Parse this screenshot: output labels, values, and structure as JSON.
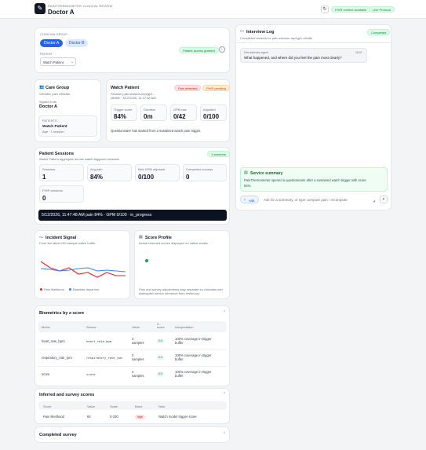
{
  "header": {
    "app_subtitle": "PainThermometer Clinical Review",
    "title": "Doctor A",
    "status_pills": [
      "FHIR context available",
      "Live Protocol"
    ]
  },
  "clinician": {
    "group_label": "Clinician group",
    "options": [
      "Doctor A",
      "Doctor B"
    ],
    "selected": "Doctor A",
    "access_badge": "Patient access granted",
    "patient_label": "Patient",
    "patient_value": "Watch Patient"
  },
  "care_group": {
    "title": "Care Group",
    "subtitle": "Geriatric pain clinician",
    "signed_in_label": "Signed in as",
    "signed_in_value": "Doctor A",
    "patients_label": "Patients",
    "patient_name": "Watch Patient",
    "patient_meta": "Age · 1 session"
  },
  "watch_patient": {
    "title": "Watch Patient",
    "badges": [
      "Pain detected",
      "FHIR pending"
    ],
    "session_line1": "Session pain-session-mp2gp1-",
    "session_line2": "c8oi8e · 5/12/2026, 11:47:48 AM",
    "stats": [
      {
        "label": "Trigger score",
        "value": "84%"
      },
      {
        "label": "Duration",
        "value": "0m"
      },
      {
        "label": "GPM raw",
        "value": "0/42"
      },
      {
        "label": "Adjusted",
        "value": "0/100"
      }
    ],
    "note": "Questionnaire has started from a sustained watch pain trigger."
  },
  "sessions": {
    "title": "Patient Sessions",
    "badge": "1 sessions",
    "subtitle": "Watch Patient aggregate across watch-triggered sessions",
    "stats": [
      {
        "label": "Sessions",
        "value": "1"
      },
      {
        "label": "Avg pain",
        "value": "84%"
      },
      {
        "label": "Max GPM adjusted",
        "value": "0/100"
      },
      {
        "label": "Completed surveys",
        "value": "0"
      },
      {
        "label": "FHIR sessions",
        "value": "0"
      }
    ],
    "row": "5/12/2026, 11:47:48 AM  pain 84% · GPM 0/100 · in_progress"
  },
  "incident": {
    "title": "Incident Signal",
    "subtitle": "From the latest 100-sample watch buffer",
    "legend": [
      "Pain likelihood",
      "Baseline departure"
    ]
  },
  "score_profile": {
    "title": "Score Profile",
    "subtitle": "Actual returned scores displayed on native scales",
    "note_line1": "Pain and survey adjustments stay separate so clinicians can",
    "note_line2": "distinguish sensor inference from testimony."
  },
  "biometrics": {
    "title": "Biometrics by z-score",
    "columns": [
      "Metric",
      "Sensor",
      "Value",
      "Z-score",
      "Interpretation"
    ],
    "rows": [
      {
        "metric": "heart_rate_bpm",
        "sensor": "heart_rate_bpm",
        "value_l1": "3",
        "value_l2": "samples",
        "z": "0.0",
        "interp_l1": "100% coverage in trigger",
        "interp_l2": "buffer"
      },
      {
        "metric": "respiratory_rate_rpm",
        "sensor": "respiratory_rate_rpm",
        "value_l1": "3",
        "value_l2": "samples",
        "z": "0.0",
        "interp_l1": "100% coverage in trigger",
        "interp_l2": "buffer"
      },
      {
        "metric": "score",
        "sensor": "score",
        "value_l1": "3",
        "value_l2": "samples",
        "z": "0.0",
        "interp_l1": "100% coverage in trigger",
        "interp_l2": "buffer"
      }
    ]
  },
  "inferred": {
    "title": "Inferred and survey scores",
    "columns": [
      "Score",
      "Value",
      "Scale",
      "Band",
      "Note"
    ],
    "rows": [
      {
        "score": "Pain likelihood",
        "value": "84",
        "scale": "0-100",
        "band": "high",
        "note": "Watch model trigger score"
      }
    ]
  },
  "completed": {
    "title": "Completed survey"
  },
  "interview": {
    "title": "Interview Log",
    "subtitle": "Completed session for pain-session-mp2gp1-c8oi8e",
    "status": "Completed",
    "message_sender": "Pain interview agent",
    "message_time": "18:47",
    "message_text": "What happened, and where did you feel the pain most clearly?",
    "summary_title": "Service summary",
    "summary_line1": "PainThermometer opened a questionnaire after a sustained watch trigger with score",
    "summary_line2": "84%.",
    "ask_label": "Ask",
    "input_placeholder": "Ask for a summary, or type compute pain / recompute"
  },
  "colors": {
    "accent": "#2563eb",
    "pain_line": "#dc2626",
    "baseline_line": "#3b82f6",
    "dark_row": "#0b1220",
    "score_dot": "#16a34a"
  }
}
